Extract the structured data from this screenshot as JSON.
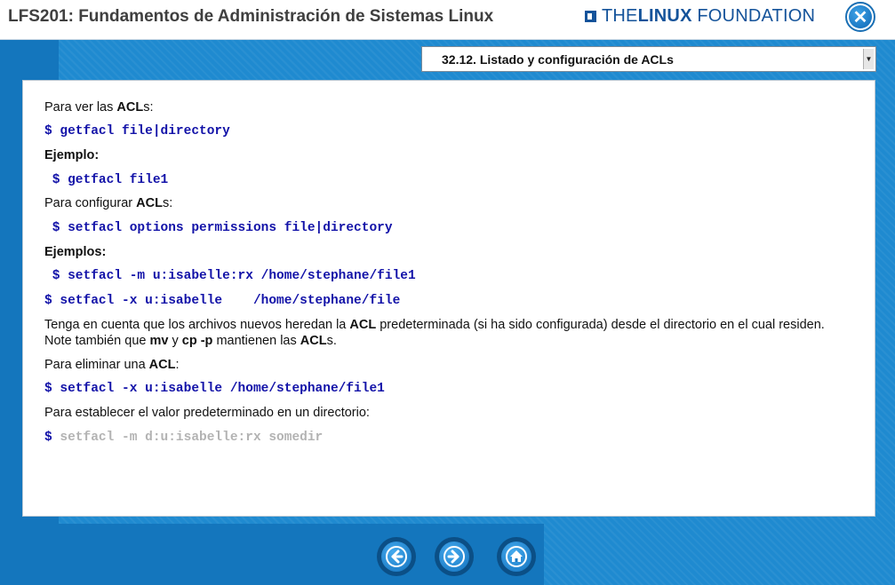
{
  "header": {
    "title": "LFS201: Fundamentos de Administración de Sistemas Linux",
    "brand_the": "THE",
    "brand_linux": "LINUX",
    "brand_foundation": "FOUNDATION",
    "close_icon": "close-icon"
  },
  "topic": {
    "selected": "32.12. Listado y configuración de ACLs"
  },
  "content": {
    "l1_pre": "Para ver las ",
    "l1_bold": "ACL",
    "l1_post": "s:",
    "code1": "$ getfacl file|directory",
    "ejemplo": "Ejemplo:",
    "code2": " $ getfacl file1",
    "l2_pre": "Para configurar ",
    "l2_bold": "ACL",
    "l2_post": "s:",
    "code3": " $ setfacl options permissions file|directory",
    "ejemplos": "Ejemplos:",
    "code4": " $ setfacl -m u:isabelle:rx /home/stephane/file1",
    "code5": "$ setfacl -x u:isabelle    /home/stephane/file",
    "p1_a": "Tenga en cuenta que los archivos nuevos heredan la ",
    "p1_b": "ACL",
    "p1_c": " predeterminada (si ha sido configurada) desde el directorio en el cual residen.",
    "p2_a": "Note también que ",
    "p2_b": "mv",
    "p2_c": " y ",
    "p2_d": "cp -p",
    "p2_e": " mantienen las ",
    "p2_f": "ACL",
    "p2_g": "s.",
    "l3_pre": "Para eliminar una ",
    "l3_bold": "ACL",
    "l3_post": ":",
    "code6": "$ setfacl -x u:isabelle /home/stephane/file1",
    "l4": "Para establecer el valor predeterminado en un directorio:",
    "code7_dollar": "$",
    "code7": " setfacl -m d:u:isabelle:rx somedir"
  },
  "nav": {
    "back_icon": "arrow-left-icon",
    "forward_icon": "arrow-right-icon",
    "home_icon": "home-icon"
  },
  "colors": {
    "background": "#1f8ad0",
    "code": "#1212a8",
    "brand": "#14539a"
  }
}
